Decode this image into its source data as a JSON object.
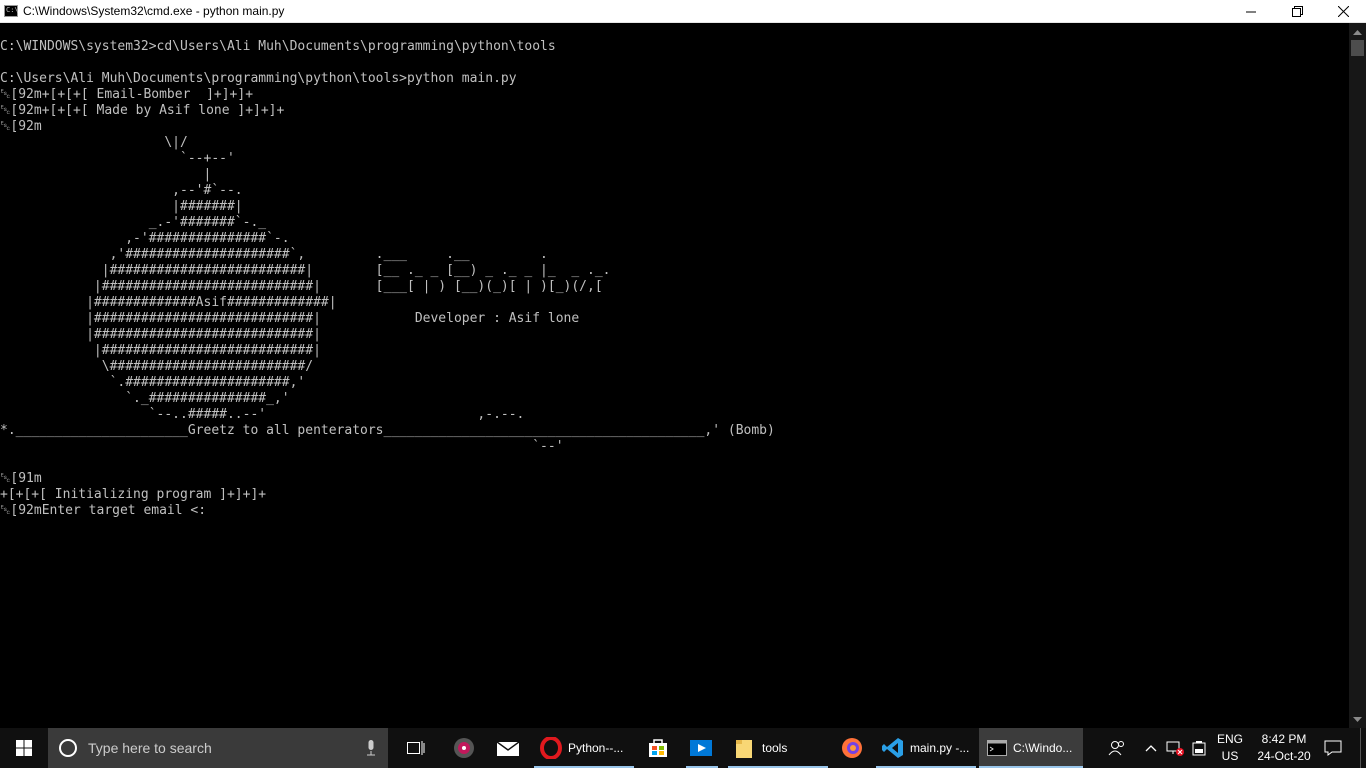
{
  "window": {
    "title": "C:\\Windows\\System32\\cmd.exe - python  main.py",
    "icon_label": "C:\\"
  },
  "console": {
    "lines": [
      "C:\\WINDOWS\\system32>cd\\Users\\Ali Muh\\Documents\\programming\\python\\tools",
      "",
      "C:\\Users\\Ali Muh\\Documents\\programming\\python\\tools>python main.py",
      "␛[92m+[+[+[ Email-Bomber  ]+]+]+",
      "␛[92m+[+[+[ Made by Asif lone ]+]+]+",
      "␛[92m",
      "                     \\|/",
      "                       `--+--'",
      "                          |",
      "                      ,--'#`--.",
      "                      |#######|",
      "                   _.-'#######`-._",
      "                ,-'###############`-.",
      "              ,'#####################`,         .___     .__         .",
      "             |#########################|        [__ ._ _ [__) _ ._ _ |_  _ ._.",
      "            |###########################|       [___[ | ) [__)(_)[ | )[_)(/,[",
      "           |#############Asif#############|",
      "           |############################|            Developer : Asif lone",
      "           |############################|",
      "            |###########################|",
      "             \\#########################/",
      "              `.#####################,'",
      "                `._###############_,'",
      "                   `--..#####..--'                           ,-.--.",
      "*.______________________Greetz to all penterators_________________________________________,' (Bomb)",
      "                                                                    `--'",
      "",
      "␛[91m",
      "+[+[+[ Initializing program ]+]+]+",
      "␛[92mEnter target email <:"
    ]
  },
  "taskbar": {
    "search_placeholder": "Type here to search",
    "apps": [
      {
        "label": "Python--..."
      },
      {
        "label": "tools"
      },
      {
        "label": "main.py -..."
      },
      {
        "label": "C:\\Windo..."
      }
    ],
    "language_top": "ENG",
    "language_bottom": "US",
    "time": "8:42 PM",
    "date": "24-Oct-20"
  },
  "colors": {
    "console_bg": "#000000",
    "console_text": "#c0c0c0",
    "taskbar_bg": "#101010",
    "active_underline": "#99c5ea"
  }
}
